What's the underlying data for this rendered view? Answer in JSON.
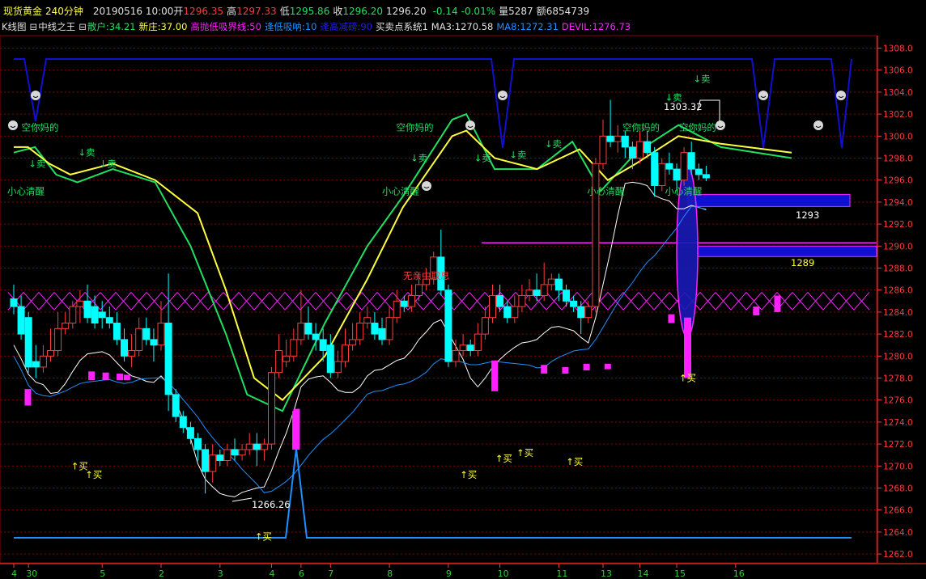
{
  "header": {
    "instrument": "现货黄金",
    "period": "240分钟",
    "datetime": "20190516 10:00",
    "open_label": "开",
    "open": "1296.35",
    "high_label": "高",
    "high": "1297.33",
    "low_label": "低",
    "low": "1295.86",
    "close_label": "收",
    "close": "1296.20",
    "last": "1296.20",
    "change": "-0.14",
    "change_pct": "-0.01%",
    "volume_label": "量",
    "volume": "5287",
    "amount_label": "额",
    "amount": "6854739"
  },
  "indicator_bar": {
    "kline": "K线图",
    "main": "中线之王",
    "retail": "散户:34.21",
    "newbanker": "新庄:37.00",
    "highlow": "高抛低吸界线:50",
    "dip": "逢低吸呐:10",
    "peak": "逢高减磅:90",
    "system": "买卖点系统1",
    "ma3": "MA3:1270.58",
    "ma8": "MA8:1272.31",
    "devil": "DEVIL:1276.73"
  },
  "colors": {
    "up": "#ff3b3b",
    "down": "#00ffff",
    "grid": "#8b0000",
    "yellow": "#ffff40",
    "green": "#20e060",
    "blue": "#1010d0",
    "magenta": "#ff20ff",
    "lightblue": "#1e90ff"
  },
  "chart_data": {
    "type": "candlestick",
    "ylim": [
      1261.5,
      1310
    ],
    "yticks": [
      "1262.0",
      "1264.0",
      "1266.0",
      "1268.0",
      "1270.0",
      "1272.0",
      "1274.0",
      "1276.0",
      "1278.0",
      "1280.0",
      "1282.0",
      "1284.0",
      "1286.0",
      "1288.0",
      "1290.0",
      "1292.0",
      "1294.0",
      "1296.0",
      "1298.0",
      "1300.0",
      "1302.0",
      "1304.0",
      "1306.0",
      "1308.0"
    ],
    "xticks": [
      {
        "label": "4",
        "bar": 0
      },
      {
        "label": "30",
        "bar": 2
      },
      {
        "label": "5",
        "bar": 12
      },
      {
        "label": "2",
        "bar": 20
      },
      {
        "label": "3",
        "bar": 28
      },
      {
        "label": "4",
        "bar": 35
      },
      {
        "label": "6",
        "bar": 39
      },
      {
        "label": "7",
        "bar": 43
      },
      {
        "label": "8",
        "bar": 51
      },
      {
        "label": "9",
        "bar": 59
      },
      {
        "label": "10",
        "bar": 66
      },
      {
        "label": "11",
        "bar": 74
      },
      {
        "label": "13",
        "bar": 80
      },
      {
        "label": "14",
        "bar": 85
      },
      {
        "label": "15",
        "bar": 90
      },
      {
        "label": "16",
        "bar": 98
      }
    ],
    "candles": [
      [
        1285.2,
        1284.5,
        1286.5,
        1283.8
      ],
      [
        1284.5,
        1282.0,
        1285.5,
        1281.5
      ],
      [
        1283.5,
        1279.0,
        1284.0,
        1278.5
      ],
      [
        1279.5,
        1279.0,
        1281.0,
        1278.0
      ],
      [
        1279.0,
        1280.0,
        1281.0,
        1278.5
      ],
      [
        1280.0,
        1280.5,
        1282.5,
        1279.5
      ],
      [
        1280.5,
        1282.5,
        1284.0,
        1280.0
      ],
      [
        1282.5,
        1283.0,
        1284.0,
        1282.0
      ],
      [
        1283.0,
        1284.5,
        1285.0,
        1282.5
      ],
      [
        1284.5,
        1285.0,
        1286.0,
        1283.0
      ],
      [
        1285.0,
        1283.5,
        1286.5,
        1283.0
      ],
      [
        1284.5,
        1283.0,
        1285.5,
        1282.5
      ],
      [
        1284.0,
        1283.5,
        1285.0,
        1282.5
      ],
      [
        1283.5,
        1283.0,
        1284.5,
        1282.5
      ],
      [
        1283.0,
        1281.5,
        1284.0,
        1281.0
      ],
      [
        1281.5,
        1280.0,
        1282.5,
        1279.5
      ],
      [
        1280.0,
        1280.5,
        1282.0,
        1279.0
      ],
      [
        1280.5,
        1282.5,
        1283.5,
        1280.0
      ],
      [
        1282.5,
        1281.5,
        1283.5,
        1281.0
      ],
      [
        1281.5,
        1281.0,
        1282.5,
        1279.5
      ],
      [
        1281.0,
        1283.0,
        1285.0,
        1280.5
      ],
      [
        1283.0,
        1276.5,
        1287.5,
        1275.0
      ],
      [
        1276.5,
        1274.5,
        1277.0,
        1274.0
      ],
      [
        1274.5,
        1273.5,
        1275.0,
        1273.0
      ],
      [
        1273.5,
        1272.5,
        1274.0,
        1272.0
      ],
      [
        1272.5,
        1271.5,
        1273.0,
        1270.5
      ],
      [
        1271.5,
        1269.5,
        1272.0,
        1267.5
      ],
      [
        1269.5,
        1271.0,
        1272.0,
        1268.5
      ],
      [
        1271.0,
        1270.5,
        1271.5,
        1270.0
      ],
      [
        1270.5,
        1271.5,
        1272.0,
        1270.0
      ],
      [
        1271.5,
        1271.0,
        1272.5,
        1270.5
      ],
      [
        1271.0,
        1271.5,
        1272.0,
        1270.5
      ],
      [
        1271.5,
        1272.0,
        1273.0,
        1271.0
      ],
      [
        1272.0,
        1271.5,
        1273.0,
        1270.0
      ],
      [
        1271.5,
        1272.0,
        1272.5,
        1270.5
      ],
      [
        1272.0,
        1278.5,
        1279.0,
        1271.5
      ],
      [
        1278.5,
        1280.5,
        1282.0,
        1278.0
      ],
      [
        1279.5,
        1280.0,
        1281.5,
        1279.0
      ],
      [
        1280.0,
        1281.5,
        1282.5,
        1279.5
      ],
      [
        1281.5,
        1283.0,
        1286.0,
        1281.0
      ],
      [
        1283.0,
        1282.0,
        1284.5,
        1281.5
      ],
      [
        1282.0,
        1281.5,
        1283.0,
        1280.5
      ],
      [
        1281.5,
        1280.5,
        1282.5,
        1279.5
      ],
      [
        1281.0,
        1278.5,
        1282.0,
        1278.0
      ],
      [
        1278.5,
        1279.5,
        1280.5,
        1278.0
      ],
      [
        1279.5,
        1281.0,
        1282.5,
        1279.0
      ],
      [
        1281.0,
        1281.5,
        1283.0,
        1280.5
      ],
      [
        1281.5,
        1283.0,
        1284.0,
        1281.0
      ],
      [
        1283.0,
        1283.5,
        1284.5,
        1282.5
      ],
      [
        1283.0,
        1282.0,
        1284.0,
        1281.5
      ],
      [
        1282.5,
        1281.5,
        1283.5,
        1281.0
      ],
      [
        1281.5,
        1283.5,
        1284.5,
        1281.0
      ],
      [
        1283.5,
        1285.0,
        1286.0,
        1283.0
      ],
      [
        1285.0,
        1284.5,
        1285.5,
        1284.0
      ],
      [
        1284.5,
        1285.5,
        1286.5,
        1284.0
      ],
      [
        1285.5,
        1286.5,
        1287.5,
        1285.0
      ],
      [
        1286.5,
        1287.0,
        1288.0,
        1286.0
      ],
      [
        1287.0,
        1289.0,
        1289.5,
        1286.5
      ],
      [
        1289.0,
        1286.0,
        1291.5,
        1285.5
      ],
      [
        1286.0,
        1279.5,
        1286.5,
        1279.0
      ],
      [
        1279.5,
        1280.5,
        1281.5,
        1279.0
      ],
      [
        1280.5,
        1281.0,
        1282.0,
        1280.0
      ],
      [
        1281.0,
        1280.5,
        1281.5,
        1280.0
      ],
      [
        1280.5,
        1282.0,
        1283.0,
        1280.0
      ],
      [
        1282.0,
        1283.5,
        1284.5,
        1281.5
      ],
      [
        1283.5,
        1285.5,
        1286.5,
        1283.0
      ],
      [
        1285.5,
        1284.5,
        1286.5,
        1284.0
      ],
      [
        1284.5,
        1283.5,
        1285.0,
        1283.0
      ],
      [
        1283.5,
        1284.5,
        1285.5,
        1283.0
      ],
      [
        1284.5,
        1285.5,
        1286.5,
        1284.0
      ],
      [
        1285.5,
        1286.0,
        1287.0,
        1285.0
      ],
      [
        1286.0,
        1285.5,
        1287.5,
        1285.0
      ],
      [
        1285.5,
        1286.5,
        1288.5,
        1285.0
      ],
      [
        1286.5,
        1287.0,
        1287.5,
        1286.0
      ],
      [
        1287.0,
        1286.0,
        1287.5,
        1285.0
      ],
      [
        1286.0,
        1285.0,
        1286.5,
        1284.5
      ],
      [
        1285.0,
        1284.5,
        1285.5,
        1284.0
      ],
      [
        1284.5,
        1283.5,
        1285.0,
        1282.0
      ],
      [
        1283.5,
        1284.5,
        1285.0,
        1283.0
      ],
      [
        1284.5,
        1297.5,
        1298.0,
        1284.0
      ],
      [
        1297.5,
        1300.0,
        1301.5,
        1297.0
      ],
      [
        1300.0,
        1299.5,
        1303.3,
        1299.0
      ],
      [
        1299.5,
        1300.0,
        1301.0,
        1298.5
      ],
      [
        1300.0,
        1299.0,
        1300.5,
        1298.0
      ],
      [
        1299.0,
        1298.0,
        1299.5,
        1297.0
      ],
      [
        1298.0,
        1299.5,
        1300.5,
        1297.5
      ],
      [
        1299.5,
        1298.5,
        1300.5,
        1298.0
      ],
      [
        1298.5,
        1295.5,
        1299.0,
        1294.5
      ],
      [
        1295.5,
        1297.5,
        1298.0,
        1295.0
      ],
      [
        1297.5,
        1297.0,
        1298.5,
        1296.5
      ],
      [
        1297.0,
        1296.0,
        1297.5,
        1295.0
      ],
      [
        1296.0,
        1298.5,
        1299.0,
        1295.5
      ],
      [
        1298.5,
        1297.0,
        1299.5,
        1296.5
      ],
      [
        1297.0,
        1296.5,
        1297.5,
        1296.0
      ],
      [
        1296.5,
        1296.2,
        1297.3,
        1295.9
      ]
    ],
    "series": [
      {
        "name": "MA3",
        "values": [
          1270.58
        ]
      },
      {
        "name": "MA8",
        "values": [
          1272.31
        ]
      },
      {
        "name": "DEVIL",
        "values": [
          1276.73
        ]
      }
    ],
    "annotations": [
      {
        "text": "1303.32",
        "bar": 80,
        "y": 1303.32,
        "kind": "high"
      },
      {
        "text": "1266.26",
        "bar": 26,
        "y": 1266.26,
        "kind": "low"
      },
      {
        "text": "1293",
        "y": 1293,
        "kind": "level"
      },
      {
        "text": "1289",
        "y": 1289,
        "kind": "level"
      },
      {
        "text": "无亲中取息",
        "bar": 47,
        "y": 1288.5,
        "kind": "text"
      },
      {
        "text": "空你妈的",
        "bar": 2,
        "y": 1300.8,
        "kind": "sell"
      },
      {
        "text": "空你妈的",
        "bar": 55,
        "y": 1300.8,
        "kind": "sell"
      },
      {
        "text": "空你妈的",
        "bar": 87,
        "y": 1300.8,
        "kind": "sell"
      },
      {
        "text": "空你妈的",
        "bar": 95,
        "y": 1300.8,
        "kind": "sell"
      },
      {
        "text": "小心清醒",
        "bar": 0,
        "y": 1295.0,
        "kind": "warn"
      },
      {
        "text": "小心清醒",
        "bar": 53,
        "y": 1295.0,
        "kind": "warn"
      },
      {
        "text": "小心清醒",
        "bar": 82,
        "y": 1295.0,
        "kind": "warn"
      },
      {
        "text": "小心清醒",
        "bar": 93,
        "y": 1295.0,
        "kind": "warn"
      },
      {
        "text": "↓卖",
        "bar": 3,
        "y": 1297.5,
        "kind": "sell"
      },
      {
        "text": "↓卖",
        "bar": 10,
        "y": 1298.5,
        "kind": "sell"
      },
      {
        "text": "↓卖",
        "bar": 13,
        "y": 1297.5,
        "kind": "sell"
      },
      {
        "text": "↓卖",
        "bar": 57,
        "y": 1298.0,
        "kind": "sell"
      },
      {
        "text": "↓卖",
        "bar": 66,
        "y": 1298.0,
        "kind": "sell"
      },
      {
        "text": "↓卖",
        "bar": 71,
        "y": 1298.3,
        "kind": "sell"
      },
      {
        "text": "↓卖",
        "bar": 76,
        "y": 1299.3,
        "kind": "sell"
      },
      {
        "text": "↓卖",
        "bar": 93,
        "y": 1303.5,
        "kind": "sell"
      },
      {
        "text": "↓卖",
        "bar": 97,
        "y": 1305.2,
        "kind": "sell"
      },
      {
        "text": "↑买",
        "bar": 9,
        "y": 1270.0,
        "kind": "buy"
      },
      {
        "text": "↑买",
        "bar": 11,
        "y": 1269.2,
        "kind": "buy"
      },
      {
        "text": "↑买",
        "bar": 35,
        "y": 1263.6,
        "kind": "buy"
      },
      {
        "text": "↑买",
        "bar": 64,
        "y": 1269.2,
        "kind": "buy"
      },
      {
        "text": "↑买",
        "bar": 69,
        "y": 1270.7,
        "kind": "buy"
      },
      {
        "text": "↑买",
        "bar": 72,
        "y": 1271.2,
        "kind": "buy"
      },
      {
        "text": "↑买",
        "bar": 79,
        "y": 1270.4,
        "kind": "buy"
      },
      {
        "text": "↑买",
        "bar": 95,
        "y": 1278.0,
        "kind": "buy"
      }
    ]
  }
}
